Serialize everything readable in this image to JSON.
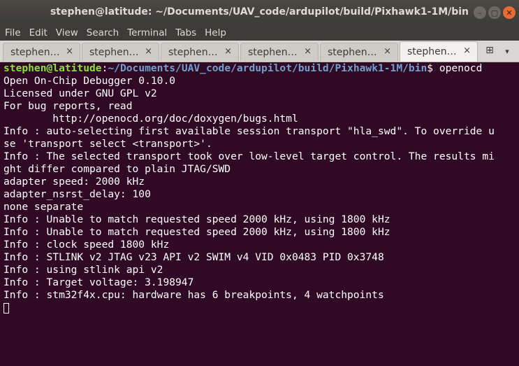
{
  "window": {
    "title": "stephen@latitude: ~/Documents/UAV_code/ardupilot/build/Pixhawk1-1M/bin",
    "minimize_glyph": "–",
    "maximize_glyph": "▢",
    "close_glyph": "✕"
  },
  "menu": {
    "items": [
      "File",
      "Edit",
      "View",
      "Search",
      "Terminal",
      "Tabs",
      "Help"
    ]
  },
  "tabs": {
    "items": [
      {
        "label": "stephen…",
        "close": "×"
      },
      {
        "label": "stephen…",
        "close": "×"
      },
      {
        "label": "stephen…",
        "close": "×"
      },
      {
        "label": "stephen…",
        "close": "×"
      },
      {
        "label": "stephen…",
        "close": "×"
      },
      {
        "label": "stephen…",
        "close": "×"
      }
    ],
    "new_tab_icon": "new-tab-icon",
    "new_tab_glyph": "⊞",
    "menu_glyph": "▾"
  },
  "terminal": {
    "prompt": {
      "user_host": "stephen@latitude",
      "colon": ":",
      "path": "~/Documents/UAV_code/ardupilot/build/Pixhawk1-1M/bin",
      "dollar": "$ ",
      "command": "openocd"
    },
    "output": [
      "Open On-Chip Debugger 0.10.0",
      "Licensed under GNU GPL v2",
      "For bug reports, read",
      "        http://openocd.org/doc/doxygen/bugs.html",
      "Info : auto-selecting first available session transport \"hla_swd\". To override u",
      "se 'transport select <transport>'.",
      "Info : The selected transport took over low-level target control. The results mi",
      "ght differ compared to plain JTAG/SWD",
      "adapter speed: 2000 kHz",
      "adapter_nsrst_delay: 100",
      "none separate",
      "Info : Unable to match requested speed 2000 kHz, using 1800 kHz",
      "Info : Unable to match requested speed 2000 kHz, using 1800 kHz",
      "Info : clock speed 1800 kHz",
      "Info : STLINK v2 JTAG v23 API v2 SWIM v4 VID 0x0483 PID 0x3748",
      "Info : using stlink api v2",
      "Info : Target voltage: 3.198947",
      "Info : stm32f4x.cpu: hardware has 6 breakpoints, 4 watchpoints"
    ]
  },
  "colors": {
    "terminal_bg": "#300a24",
    "prompt_user": "#8ae234",
    "prompt_path": "#729fcf",
    "close_button": "#e86b35"
  }
}
